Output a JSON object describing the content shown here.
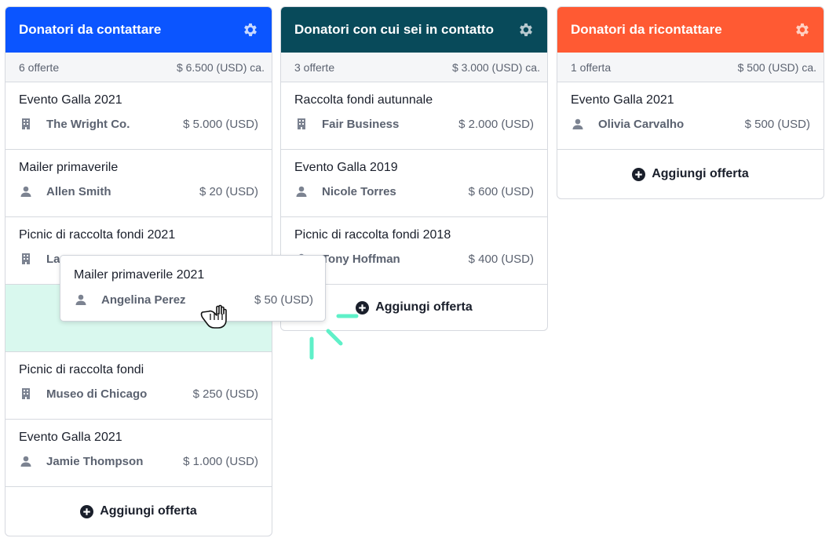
{
  "colors": {
    "col1": "#0b55ff",
    "col2": "#084a5a",
    "col3": "#ff5a33",
    "drop_zone": "#d9f8ee",
    "spinner": "#5ff0c8"
  },
  "columns": [
    {
      "title": "Donatori da contattare",
      "summary_count": "6 offerte",
      "summary_total": "$ 6.500 (USD) ca.",
      "add_label": "Aggiungi offerta",
      "cards": [
        {
          "title": "Evento Galla 2021",
          "contact": "The Wright Co.",
          "contact_icon": "building-icon",
          "amount": "$ 5.000 (USD)"
        },
        {
          "title": "Mailer primaverile",
          "contact": "Allen Smith",
          "contact_icon": "person-icon",
          "amount": "$ 20 (USD)"
        },
        {
          "title": "Picnic di raccolta fondi 2021",
          "contact": "La",
          "contact_icon": "building-icon",
          "amount": ""
        },
        {
          "title": "Picnic di raccolta fondi",
          "contact": "Museo di Chicago",
          "contact_icon": "building-icon",
          "amount": "$ 250 (USD)"
        },
        {
          "title": "Evento Galla 2021",
          "contact": "Jamie Thompson",
          "contact_icon": "person-icon",
          "amount": "$ 1.000 (USD)"
        }
      ]
    },
    {
      "title": "Donatori con cui sei in contatto",
      "summary_count": "3 offerte",
      "summary_total": "$ 3.000 (USD) ca.",
      "add_label": "Aggiungi offerta",
      "cards": [
        {
          "title": "Raccolta fondi autunnale",
          "contact": "Fair Business",
          "contact_icon": "building-icon",
          "amount": "$ 2.000 (USD)"
        },
        {
          "title": "Evento Galla 2019",
          "contact": "Nicole Torres",
          "contact_icon": "person-icon",
          "amount": "$ 600 (USD)"
        },
        {
          "title": "Picnic di raccolta fondi 2018",
          "contact": "Tony Hoffman",
          "contact_icon": "person-icon",
          "amount": "$ 400 (USD)"
        }
      ]
    },
    {
      "title": "Donatori da ricontattare",
      "summary_count": "1 offerta",
      "summary_total": "$ 500 (USD) ca.",
      "add_label": "Aggiungi offerta",
      "cards": [
        {
          "title": "Evento Galla 2021",
          "contact": "Olivia Carvalho",
          "contact_icon": "person-icon",
          "amount": "$ 500 (USD)"
        }
      ]
    }
  ],
  "dragging_card": {
    "title": "Mailer primaverile 2021",
    "contact": "Angelina Perez",
    "contact_icon": "person-icon",
    "amount": "$ 50 (USD)"
  },
  "cursor_icon": "grab-hand-icon",
  "loading_icon": "spinner-icon"
}
